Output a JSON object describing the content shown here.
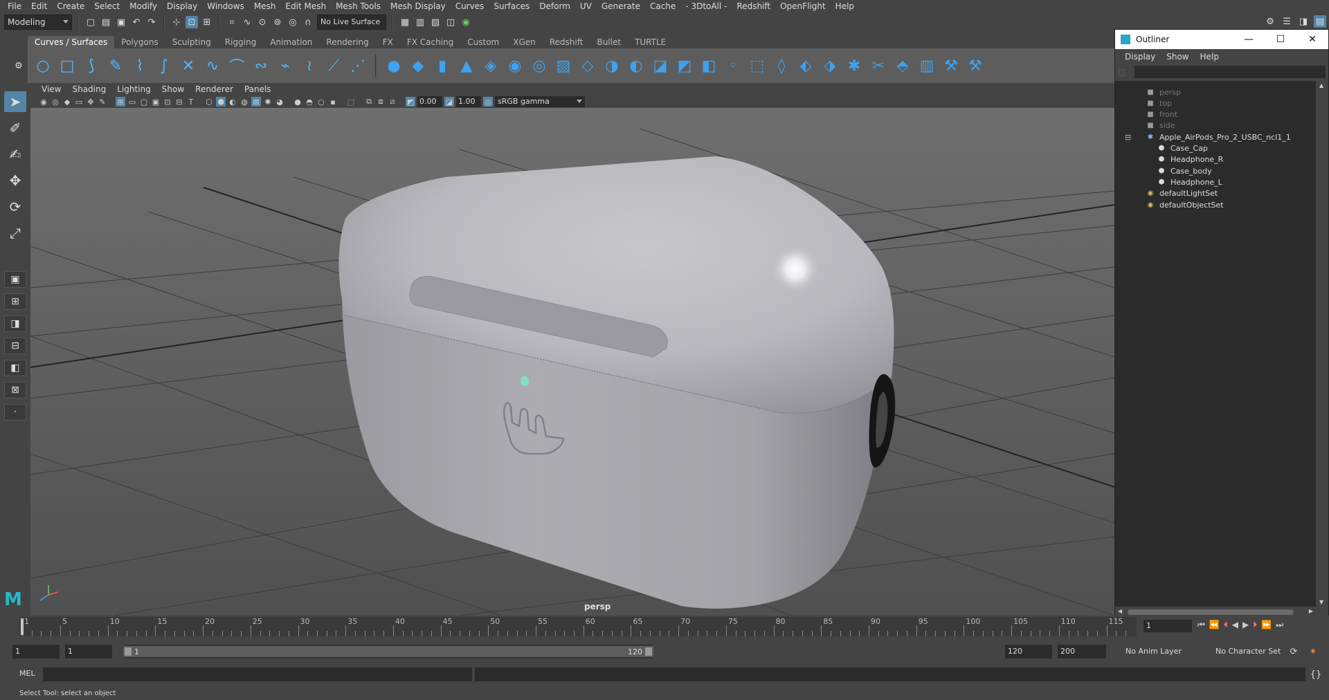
{
  "menubar": [
    "File",
    "Edit",
    "Create",
    "Select",
    "Modify",
    "Display",
    "Windows",
    "Mesh",
    "Edit Mesh",
    "Mesh Tools",
    "Mesh Display",
    "Curves",
    "Surfaces",
    "Deform",
    "UV",
    "Generate",
    "Cache",
    "- 3DtoAll -",
    "Redshift",
    "OpenFlight",
    "Help"
  ],
  "statusline": {
    "mode": "Modeling",
    "live_surface": "No Live Surface"
  },
  "shelf_tabs": [
    "Curves / Surfaces",
    "Polygons",
    "Sculpting",
    "Rigging",
    "Animation",
    "Rendering",
    "FX",
    "FX Caching",
    "Custom",
    "XGen",
    "Redshift",
    "Bullet",
    "TURTLE"
  ],
  "shelf_active": "Curves / Surfaces",
  "panel_menu": [
    "View",
    "Shading",
    "Lighting",
    "Show",
    "Renderer",
    "Panels"
  ],
  "panel_toolbar": {
    "exposure": "0.00",
    "gamma": "1.00",
    "color_space": "sRGB gamma"
  },
  "viewport": {
    "camera_label": "persp",
    "accent": "#5285a6"
  },
  "outliner": {
    "title": "Outliner",
    "menu": [
      "Display",
      "Show",
      "Help"
    ],
    "items": [
      {
        "label": "persp",
        "kind": "camera",
        "indent": 2,
        "dim": true
      },
      {
        "label": "top",
        "kind": "camera",
        "indent": 2,
        "dim": true
      },
      {
        "label": "front",
        "kind": "camera",
        "indent": 2,
        "dim": true
      },
      {
        "label": "side",
        "kind": "camera",
        "indent": 2,
        "dim": true
      },
      {
        "label": "Apple_AirPods_Pro_2_USBC_ncl1_1",
        "kind": "group",
        "indent": 2,
        "dim": false
      },
      {
        "label": "Case_Cap",
        "kind": "mesh",
        "indent": 3,
        "dim": false
      },
      {
        "label": "Headphone_R",
        "kind": "mesh",
        "indent": 3,
        "dim": false
      },
      {
        "label": "Case_body",
        "kind": "mesh",
        "indent": 3,
        "dim": false
      },
      {
        "label": "Headphone_L",
        "kind": "mesh",
        "indent": 3,
        "dim": false
      },
      {
        "label": "defaultLightSet",
        "kind": "set",
        "indent": 2,
        "dim": false
      },
      {
        "label": "defaultObjectSet",
        "kind": "set",
        "indent": 2,
        "dim": false
      }
    ]
  },
  "timeslider": {
    "ticks": [
      "1",
      "5",
      "10",
      "15",
      "20",
      "25",
      "30",
      "35",
      "40",
      "45",
      "50",
      "55",
      "60",
      "65",
      "70",
      "75",
      "80",
      "85",
      "90",
      "95",
      "100",
      "105",
      "110",
      "115"
    ],
    "current_frame": "1"
  },
  "range": {
    "start": "1",
    "playback_start": "1",
    "range_start": "1",
    "range_end": "120",
    "playback_end": "120",
    "end": "200",
    "anim_layer": "No Anim Layer",
    "character_set": "No Character Set"
  },
  "cmdline": {
    "label": "MEL"
  },
  "helpline": "Select Tool: select an object"
}
